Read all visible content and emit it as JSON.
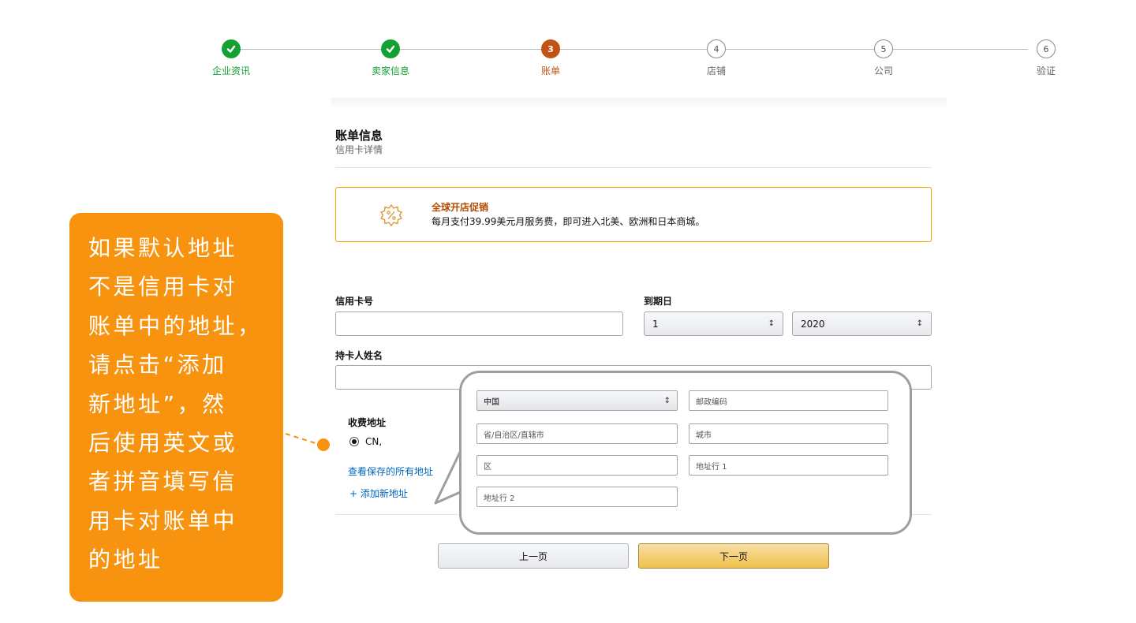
{
  "stepper": {
    "steps": [
      {
        "label": "企业资讯",
        "state": "done",
        "badge": ""
      },
      {
        "label": "卖家信息",
        "state": "done",
        "badge": ""
      },
      {
        "label": "账单",
        "state": "current",
        "badge": "3"
      },
      {
        "label": "店铺",
        "state": "todo",
        "badge": "4"
      },
      {
        "label": "公司",
        "state": "todo",
        "badge": "5"
      },
      {
        "label": "验证",
        "state": "todo",
        "badge": "6"
      }
    ]
  },
  "section": {
    "title": "账单信息",
    "subtitle": "信用卡详情"
  },
  "promo": {
    "title": "全球开店促销",
    "text": "每月支付39.99美元月服务费，即可进入北美、欧洲和日本商城。"
  },
  "form": {
    "card_number_label": "信用卡号",
    "card_number_value": "",
    "expiry_label": "到期日",
    "expiry_month": "1",
    "expiry_year": "2020",
    "holder_label": "持卡人姓名",
    "holder_value": ""
  },
  "billing": {
    "title": "收费地址",
    "selected_address": "CN,",
    "view_all_link": "查看保存的所有地址",
    "add_new_link": "+ 添加新地址"
  },
  "zoom": {
    "country": "中国",
    "postal_placeholder": "邮政编码",
    "province_placeholder": "省/自治区/直辖市",
    "city_placeholder": "城市",
    "district_placeholder": "区",
    "address1_placeholder": "地址行 1",
    "address2_placeholder": "地址行 2"
  },
  "buttons": {
    "prev": "上一页",
    "next": "下一页"
  },
  "annotation": {
    "text": "如果默认地址\n不是信用卡对\n账单中的地址，\n请点击“添加\n新地址”，然\n后使用英文或\n者拼音填写信\n用卡对账单中\n的地址"
  },
  "colors": {
    "done": "#14a032",
    "current": "#c25413",
    "annotation": "#f7930e",
    "promo_border": "#f0a200",
    "link": "#0066c0"
  }
}
